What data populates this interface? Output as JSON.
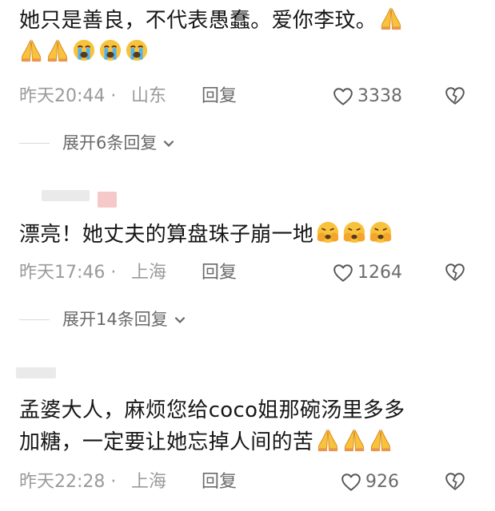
{
  "comments": [
    {
      "text": "她只是善良，不代表愚蠢。爱你李玟。",
      "emoji_line1": [
        "pray-emoji"
      ],
      "emoji_line2": [
        "pray-emoji",
        "pray-emoji",
        "crying-emoji",
        "crying-emoji",
        "crying-emoji"
      ],
      "time": "昨天20:44",
      "sep": "·",
      "location": "山东",
      "reply_label": "回复",
      "likes": "3338",
      "expand_label": "展开6条回复"
    },
    {
      "text": "漂亮！她丈夫的算盘珠子崩一地",
      "emoji_line1": [
        "shushing-emoji",
        "shushing-emoji",
        "shushing-emoji"
      ],
      "time": "昨天17:46",
      "sep": "·",
      "location": "上海",
      "reply_label": "回复",
      "likes": "1264",
      "expand_label": "展开14条回复"
    },
    {
      "text_line1": "孟婆大人，麻烦您给coco姐那碗汤里多多",
      "text_line2": "加糖，一定要让她忘掉人间的苦",
      "emoji_line2": [
        "pray-emoji",
        "pray-emoji",
        "pray-emoji"
      ],
      "time": "昨天22:28",
      "sep": "·",
      "location": "上海",
      "reply_label": "回复",
      "likes": "926"
    }
  ],
  "colors": {
    "text": "#161616",
    "meta": "#9a9a9a",
    "emoji_yellow": "#f9c23c",
    "tear_blue": "#4fb3f0"
  }
}
